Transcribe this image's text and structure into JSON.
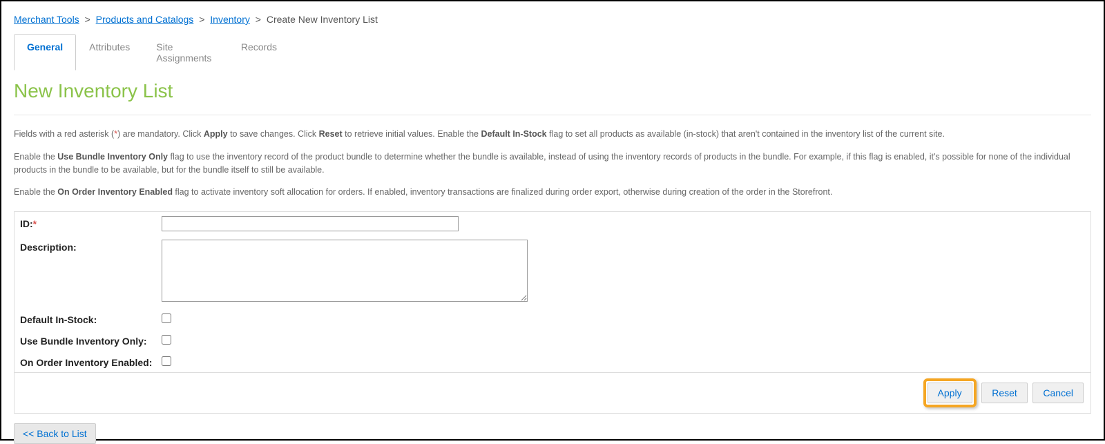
{
  "breadcrumb": {
    "items": [
      {
        "label": "Merchant Tools",
        "link": true
      },
      {
        "label": "Products and Catalogs",
        "link": true
      },
      {
        "label": "Inventory",
        "link": true
      },
      {
        "label": "Create New Inventory List",
        "link": false
      }
    ],
    "sep": ">"
  },
  "tabs": [
    {
      "label": "General",
      "active": true
    },
    {
      "label": "Attributes",
      "active": false
    },
    {
      "label": "Site Assignments",
      "active": false
    },
    {
      "label": "Records",
      "active": false
    }
  ],
  "page_title": "New Inventory List",
  "help": {
    "p1_a": "Fields with a red asterisk (",
    "p1_ast": "*",
    "p1_b": ") are mandatory. Click ",
    "p1_apply": "Apply",
    "p1_c": " to save changes. Click ",
    "p1_reset": "Reset",
    "p1_d": " to retrieve initial values. Enable the ",
    "p1_dis": "Default In-Stock",
    "p1_e": " flag to set all products as available (in-stock) that aren't contained in the inventory list of the current site.",
    "p2_a": "Enable the ",
    "p2_b": "Use Bundle Inventory Only",
    "p2_c": " flag to use the inventory record of the product bundle to determine whether the bundle is available, instead of using the inventory records of products in the bundle. For example, if this flag is enabled, it's possible for none of the individual products in the bundle to be available, but for the bundle itself to still be available.",
    "p3_a": "Enable the ",
    "p3_b": "On Order Inventory Enabled",
    "p3_c": " flag to activate inventory soft allocation for orders. If enabled, inventory transactions are finalized during order export, otherwise during creation of the order in the Storefront."
  },
  "form": {
    "id_label": "ID:",
    "id_value": "",
    "desc_label": "Description:",
    "desc_value": "",
    "default_instock_label": "Default In-Stock:",
    "use_bundle_label": "Use Bundle Inventory Only:",
    "on_order_label": "On Order Inventory Enabled:"
  },
  "buttons": {
    "apply": "Apply",
    "reset": "Reset",
    "cancel": "Cancel",
    "back": "<< Back to List"
  }
}
